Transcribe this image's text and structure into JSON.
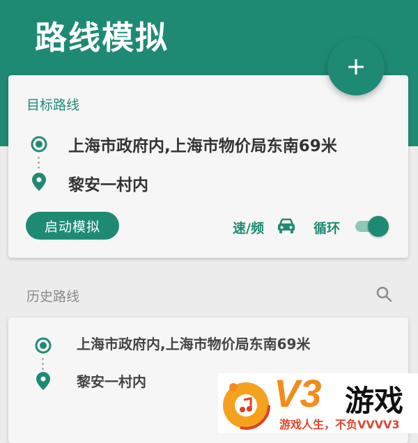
{
  "header": {
    "title": "路线模拟",
    "color": "#1f8a74"
  },
  "fab": {
    "icon": "plus-icon"
  },
  "target_route": {
    "label": "目标路线",
    "start": "上海市政府内,上海市物价局东南69米",
    "end": "黎安一村内",
    "start_button": "启动模拟",
    "speed_label": "速/频",
    "speed_icon": "car-icon",
    "loop_label": "循环",
    "loop_enabled": true
  },
  "history": {
    "label": "历史路线",
    "search_icon": "search-icon",
    "items": [
      {
        "start": "上海市政府内,上海市物价局东南69米",
        "end": "黎安一村内"
      }
    ]
  },
  "watermark": {
    "brand": "V3",
    "name": "游戏",
    "slogan": "游戏人生，不负VVVV3"
  }
}
